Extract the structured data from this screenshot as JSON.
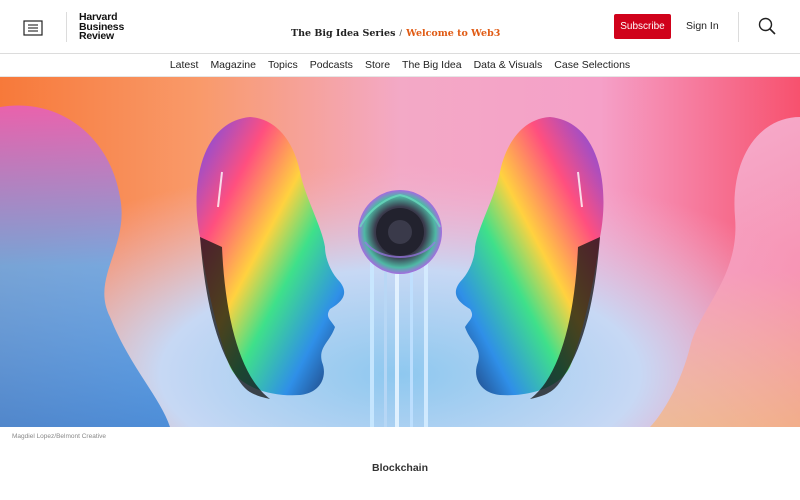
{
  "header": {
    "logo_lines": [
      "Harvard",
      "Business",
      "Review"
    ],
    "breadcrumb": {
      "series": "The Big Idea Series",
      "separator": "/",
      "current": "Welcome to Web3"
    },
    "subscribe_label": "Subscribe",
    "signin_label": "Sign In",
    "icons": {
      "menu": "menu-icon",
      "search": "search-icon"
    },
    "colors": {
      "subscribe_bg": "#d0021b",
      "current_crumb": "#e05a13"
    }
  },
  "nav": {
    "items": [
      "Latest",
      "Magazine",
      "Topics",
      "Podcasts",
      "Store",
      "The Big Idea",
      "Data & Visuals",
      "Case Selections"
    ]
  },
  "hero": {
    "caption": "Magdiel Lopez/Belmont Creative"
  },
  "article": {
    "topic": "Blockchain"
  }
}
